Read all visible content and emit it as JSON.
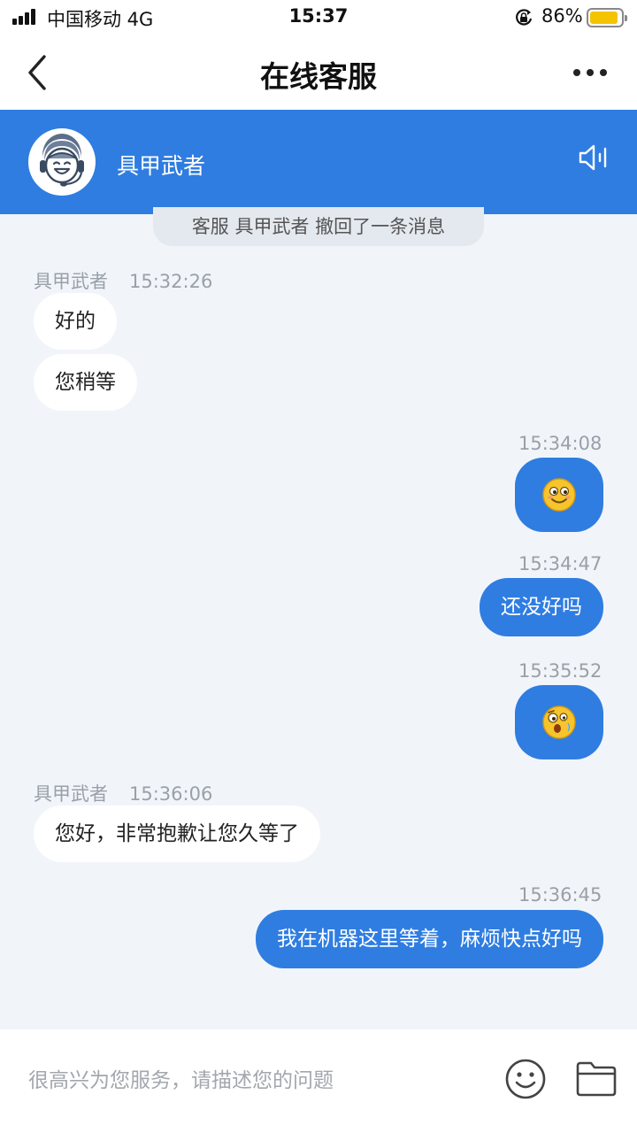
{
  "status_bar": {
    "carrier": "中国移动   4G",
    "time": "15:37",
    "battery_percent": "86%",
    "battery_level": 0.86,
    "battery_color": "#f5c400"
  },
  "nav": {
    "title": "在线客服",
    "back_icon": "chevron-left-icon",
    "more_icon": "more-horizontal-icon"
  },
  "agent": {
    "name": "具甲武者",
    "avatar_icon": "support-agent-headset-icon",
    "speaker_icon": "speaker-icon"
  },
  "chat": {
    "recall_notice": "客服 具甲武者 撤回了一条消息",
    "groups": [
      {
        "sender": "具甲武者",
        "time": "15:32:26",
        "messages": [
          "好的",
          "您稍等"
        ]
      },
      {
        "time": "15:34:08",
        "emoji": "smiling-face-emoji"
      },
      {
        "time": "15:34:47",
        "message": "还没好吗"
      },
      {
        "time": "15:35:52",
        "emoji": "surprised-face-emoji"
      },
      {
        "sender": "具甲武者",
        "time": "15:36:06",
        "messages": [
          "您好，非常抱歉让您久等了"
        ]
      },
      {
        "time": "15:36:45",
        "message": "我在机器这里等着，麻烦快点好吗"
      }
    ]
  },
  "input": {
    "placeholder": "很高兴为您服务，请描述您的问题",
    "emoji_button_icon": "smile-icon",
    "file_button_icon": "folder-icon"
  },
  "colors": {
    "brand_blue": "#2f7de1",
    "chat_background": "#f1f5fa",
    "incoming_bubble": "#ffffff"
  }
}
